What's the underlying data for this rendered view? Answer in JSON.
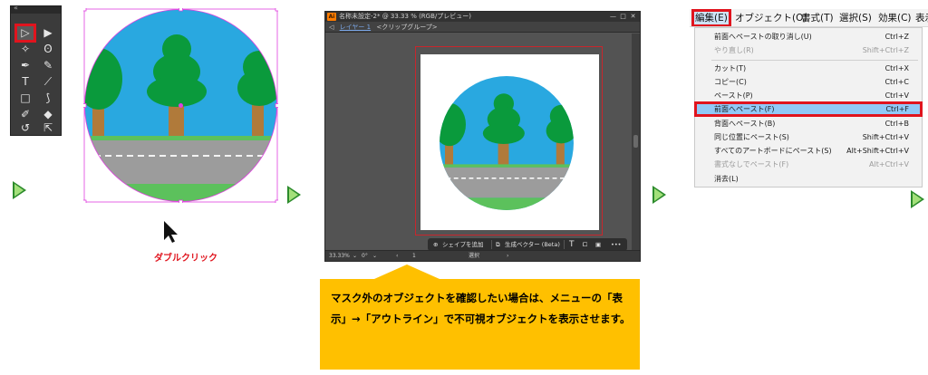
{
  "tools_panel": {
    "grip_label": "«",
    "tools": [
      {
        "name": "selection-tool",
        "glyph": "▷",
        "selected": true
      },
      {
        "name": "direct-selection-tool",
        "glyph": "▶"
      },
      {
        "name": "magic-wand-tool",
        "glyph": "✧"
      },
      {
        "name": "lasso-tool",
        "glyph": "ʘ"
      },
      {
        "name": "pen-tool",
        "glyph": "✒"
      },
      {
        "name": "curvature-tool",
        "glyph": "✎"
      },
      {
        "name": "type-tool",
        "glyph": "T"
      },
      {
        "name": "line-tool",
        "glyph": "⟋"
      },
      {
        "name": "rectangle-tool",
        "glyph": "□"
      },
      {
        "name": "paintbrush-tool",
        "glyph": "⟆"
      },
      {
        "name": "shaper-tool",
        "glyph": "✐"
      },
      {
        "name": "eraser-tool",
        "glyph": "◆"
      },
      {
        "name": "rotate-tool",
        "glyph": "↺"
      },
      {
        "name": "scale-tool",
        "glyph": "⇱"
      }
    ]
  },
  "step1": {
    "caption": "ダブルクリック"
  },
  "app_window": {
    "title": "名称未設定-2* @ 33.33 % (RGB/プレビュー)",
    "window_buttons": [
      "—",
      "□",
      "✕"
    ],
    "isolation_bar": {
      "back": "◁",
      "layer": "レイヤー 1",
      "group": "<クリップグループ>"
    },
    "status_bar": {
      "zoom": "33.33%",
      "rotation": "0°",
      "artboard": "1",
      "mode": "選択"
    },
    "context_bar": {
      "add_shape": "シェイプを追加",
      "generate_vector": "生成ベクター (Beta)"
    }
  },
  "callout": {
    "text": "マスク外のオブジェクトを確認したい場合は、メニューの「表示」→「アウトライン」で不可視オブジェクトを表示させます。"
  },
  "menu_bar": {
    "items": [
      "編集(E)",
      "オブジェクト(O)",
      "書式(T)",
      "選択(S)",
      "効果(C)",
      "表示"
    ]
  },
  "edit_menu": {
    "items": [
      {
        "label": "前面へペーストの取り消し(U)",
        "shortcut": "Ctrl+Z",
        "disabled": false
      },
      {
        "label": "やり直し(R)",
        "shortcut": "Shift+Ctrl+Z",
        "disabled": true
      },
      {
        "label": "カット(T)",
        "shortcut": "Ctrl+X",
        "disabled": false
      },
      {
        "label": "コピー(C)",
        "shortcut": "Ctrl+C",
        "disabled": false
      },
      {
        "label": "ペースト(P)",
        "shortcut": "Ctrl+V",
        "disabled": false
      },
      {
        "label": "前面へペースト(F)",
        "shortcut": "Ctrl+F",
        "disabled": false,
        "highlighted": true
      },
      {
        "label": "背面へペースト(B)",
        "shortcut": "Ctrl+B",
        "disabled": false
      },
      {
        "label": "同じ位置にペースト(S)",
        "shortcut": "Shift+Ctrl+V",
        "disabled": false
      },
      {
        "label": "すべてのアートボードにペースト(S)",
        "shortcut": "Alt+Shift+Ctrl+V",
        "disabled": false
      },
      {
        "label": "書式なしでペースト(F)",
        "shortcut": "Alt+Ctrl+V",
        "disabled": true
      },
      {
        "label": "消去(L)",
        "shortcut": "",
        "disabled": false
      }
    ]
  },
  "colors": {
    "sky": "#29a8e0",
    "tree_leaf": "#0a9a3c",
    "trunk": "#b07a3a",
    "road": "#9c9c9c",
    "grass": "#5cc15c",
    "highlight_red": "#e0141e",
    "callout": "#ffc000",
    "arrow": "#2c8b2c"
  }
}
